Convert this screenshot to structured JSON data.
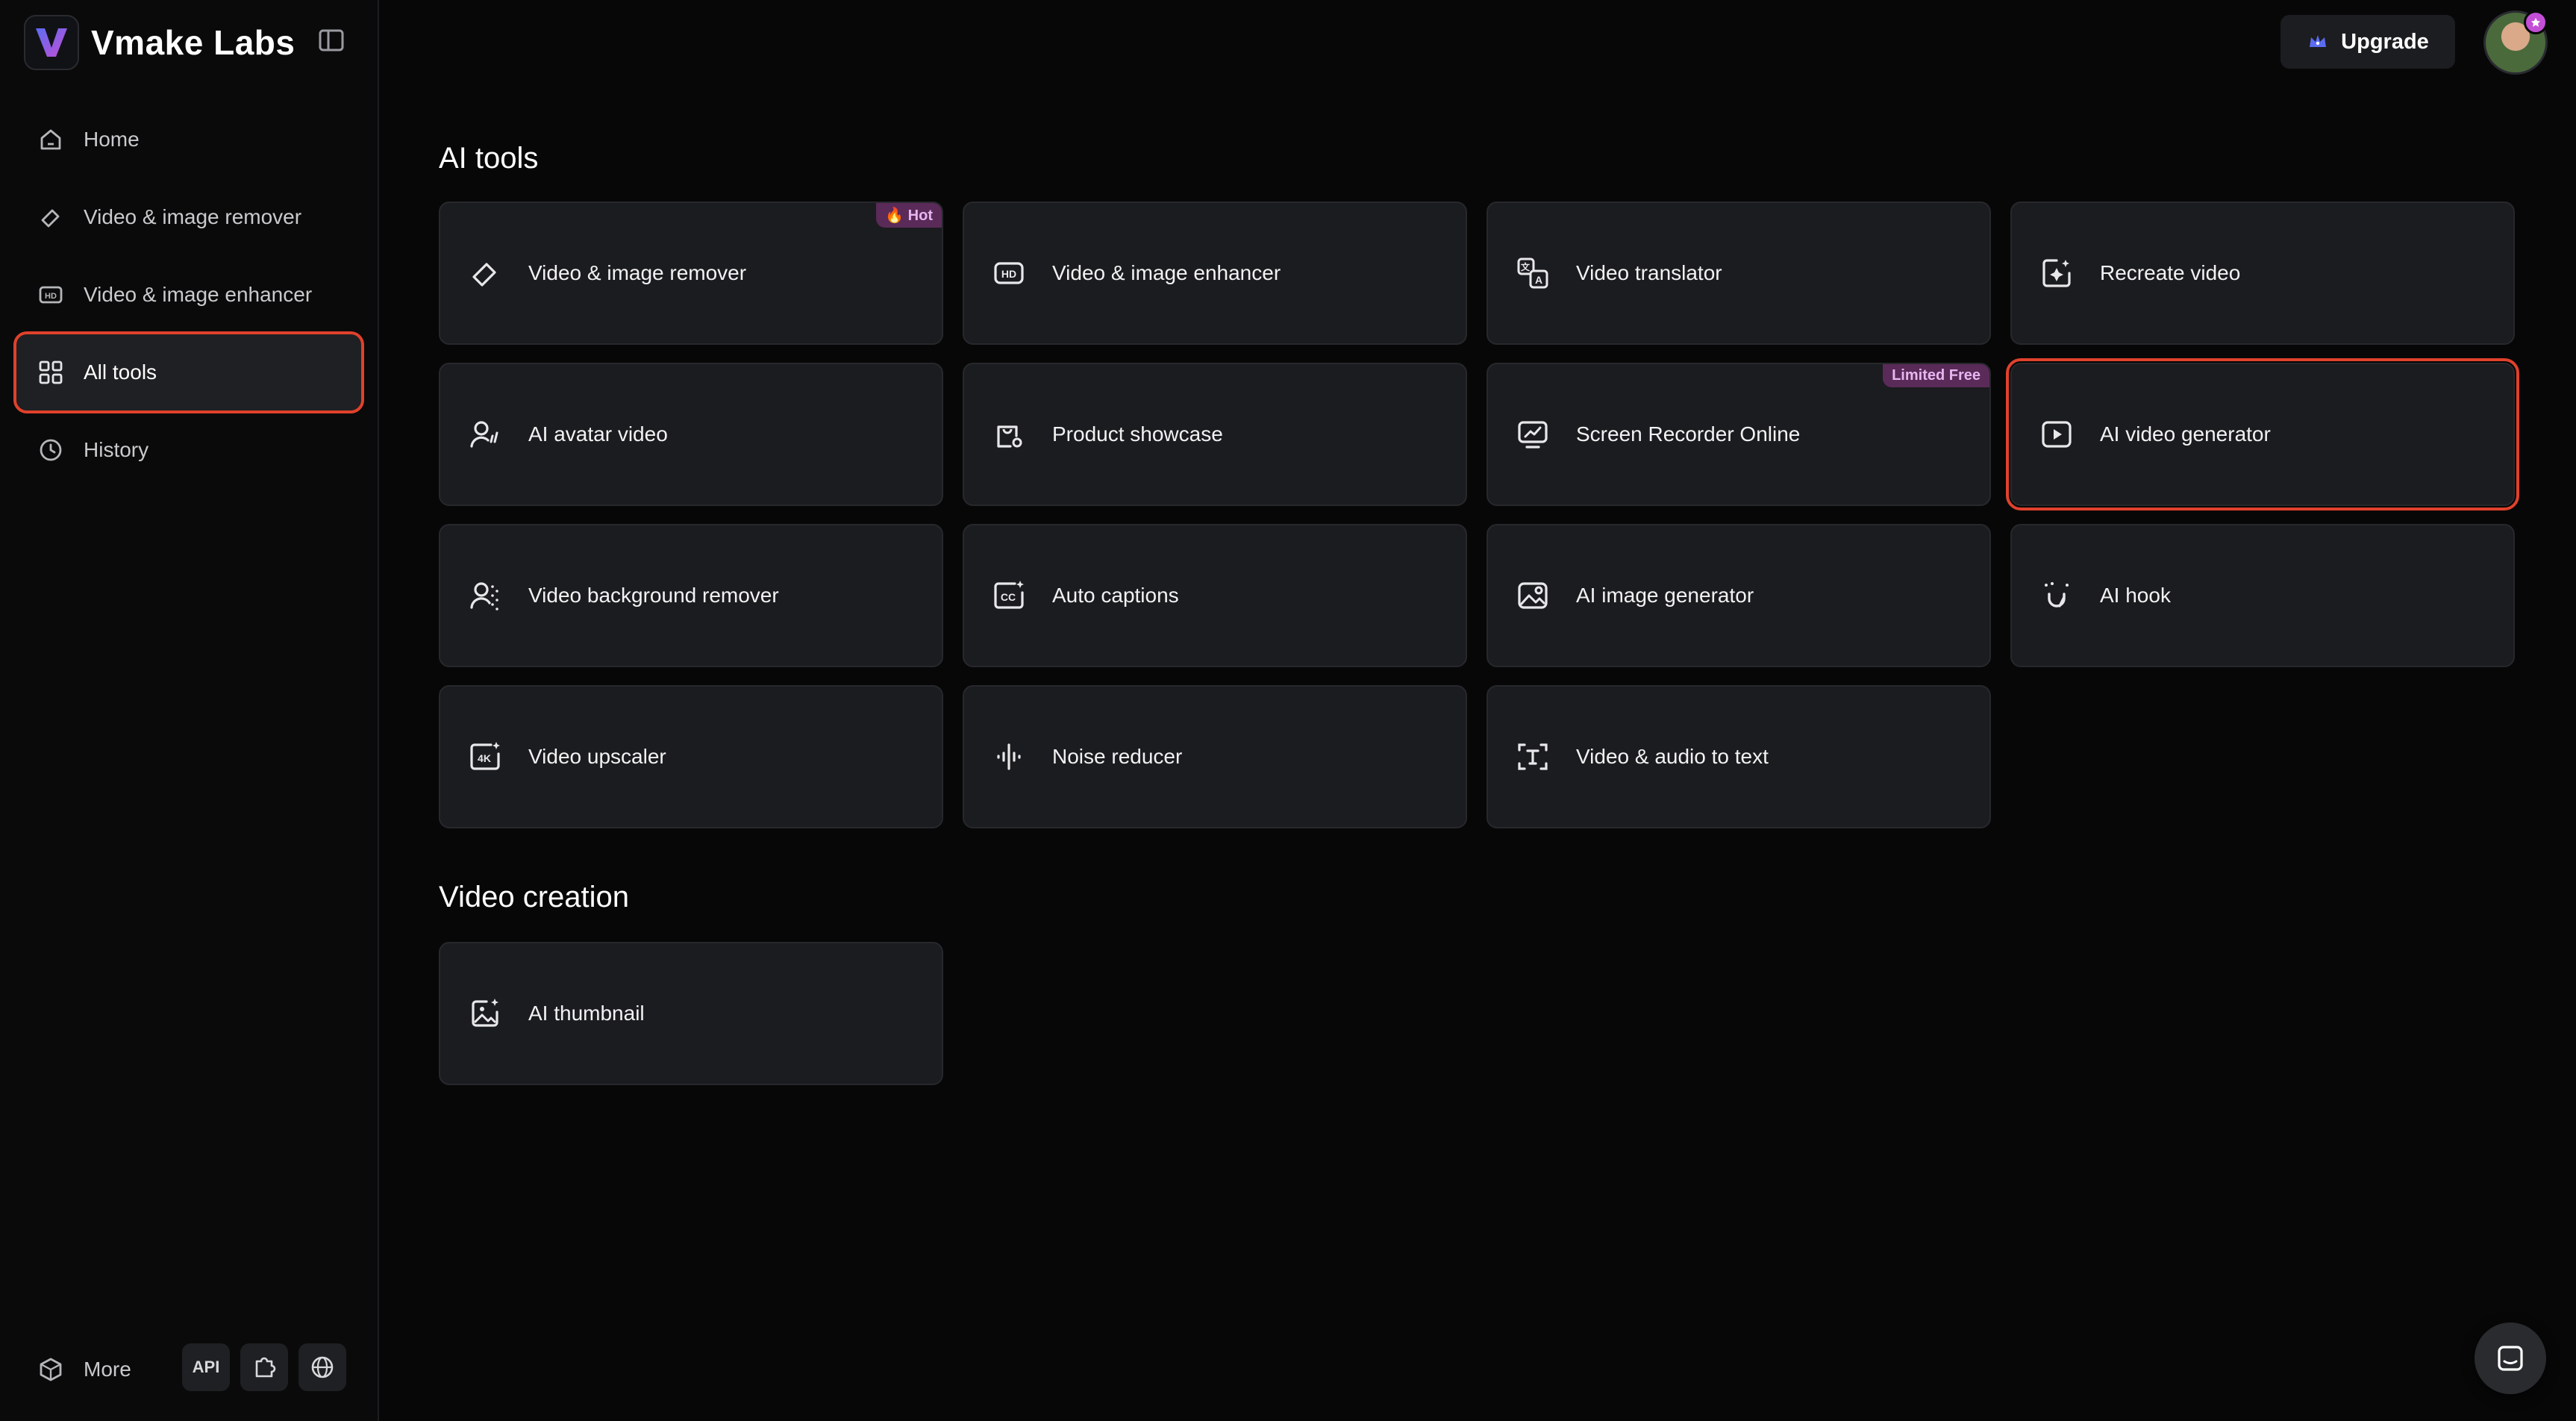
{
  "brand": {
    "name": "Vmake Labs"
  },
  "sidebar": {
    "items": [
      {
        "label": "Home",
        "icon": "home-icon"
      },
      {
        "label": "Video & image remover",
        "icon": "eraser-icon"
      },
      {
        "label": "Video & image enhancer",
        "icon": "hd-icon"
      },
      {
        "label": "All tools",
        "icon": "grid-icon",
        "active": true
      },
      {
        "label": "History",
        "icon": "clock-icon"
      }
    ],
    "more_label": "More",
    "api_label": "API"
  },
  "header": {
    "upgrade_label": "Upgrade"
  },
  "sections": {
    "ai_tools_title": "AI tools",
    "video_creation_title": "Video creation"
  },
  "tools": [
    {
      "label": "Video & image remover",
      "icon": "eraser-icon",
      "badge": "🔥 Hot"
    },
    {
      "label": "Video & image enhancer",
      "icon": "hd-icon"
    },
    {
      "label": "Video translator",
      "icon": "translate-icon"
    },
    {
      "label": "Recreate video",
      "icon": "recreate-icon"
    },
    {
      "label": "AI avatar video",
      "icon": "avatar-voice-icon"
    },
    {
      "label": "Product showcase",
      "icon": "shopping-bag-icon"
    },
    {
      "label": "Screen Recorder Online",
      "icon": "screen-recorder-icon",
      "badge": "Limited Free"
    },
    {
      "label": "AI video generator",
      "icon": "play-icon",
      "highlighted": true
    },
    {
      "label": "Video background remover",
      "icon": "person-bg-remove-icon"
    },
    {
      "label": "Auto captions",
      "icon": "cc-icon"
    },
    {
      "label": "AI image generator",
      "icon": "image-icon"
    },
    {
      "label": "AI hook",
      "icon": "magnet-icon"
    },
    {
      "label": "Video upscaler",
      "icon": "4k-icon"
    },
    {
      "label": "Noise reducer",
      "icon": "waveform-icon"
    },
    {
      "label": "Video & audio to text",
      "icon": "text-scan-icon"
    }
  ],
  "creation_tools": [
    {
      "label": "AI thumbnail",
      "icon": "thumbnail-icon"
    }
  ],
  "colors": {
    "background": "#070707",
    "card": "#1b1c1f",
    "highlight": "#e0412c",
    "badge": "#5a2a59",
    "brand_gradient": [
      "#5b6cf2",
      "#c34fd6"
    ]
  }
}
